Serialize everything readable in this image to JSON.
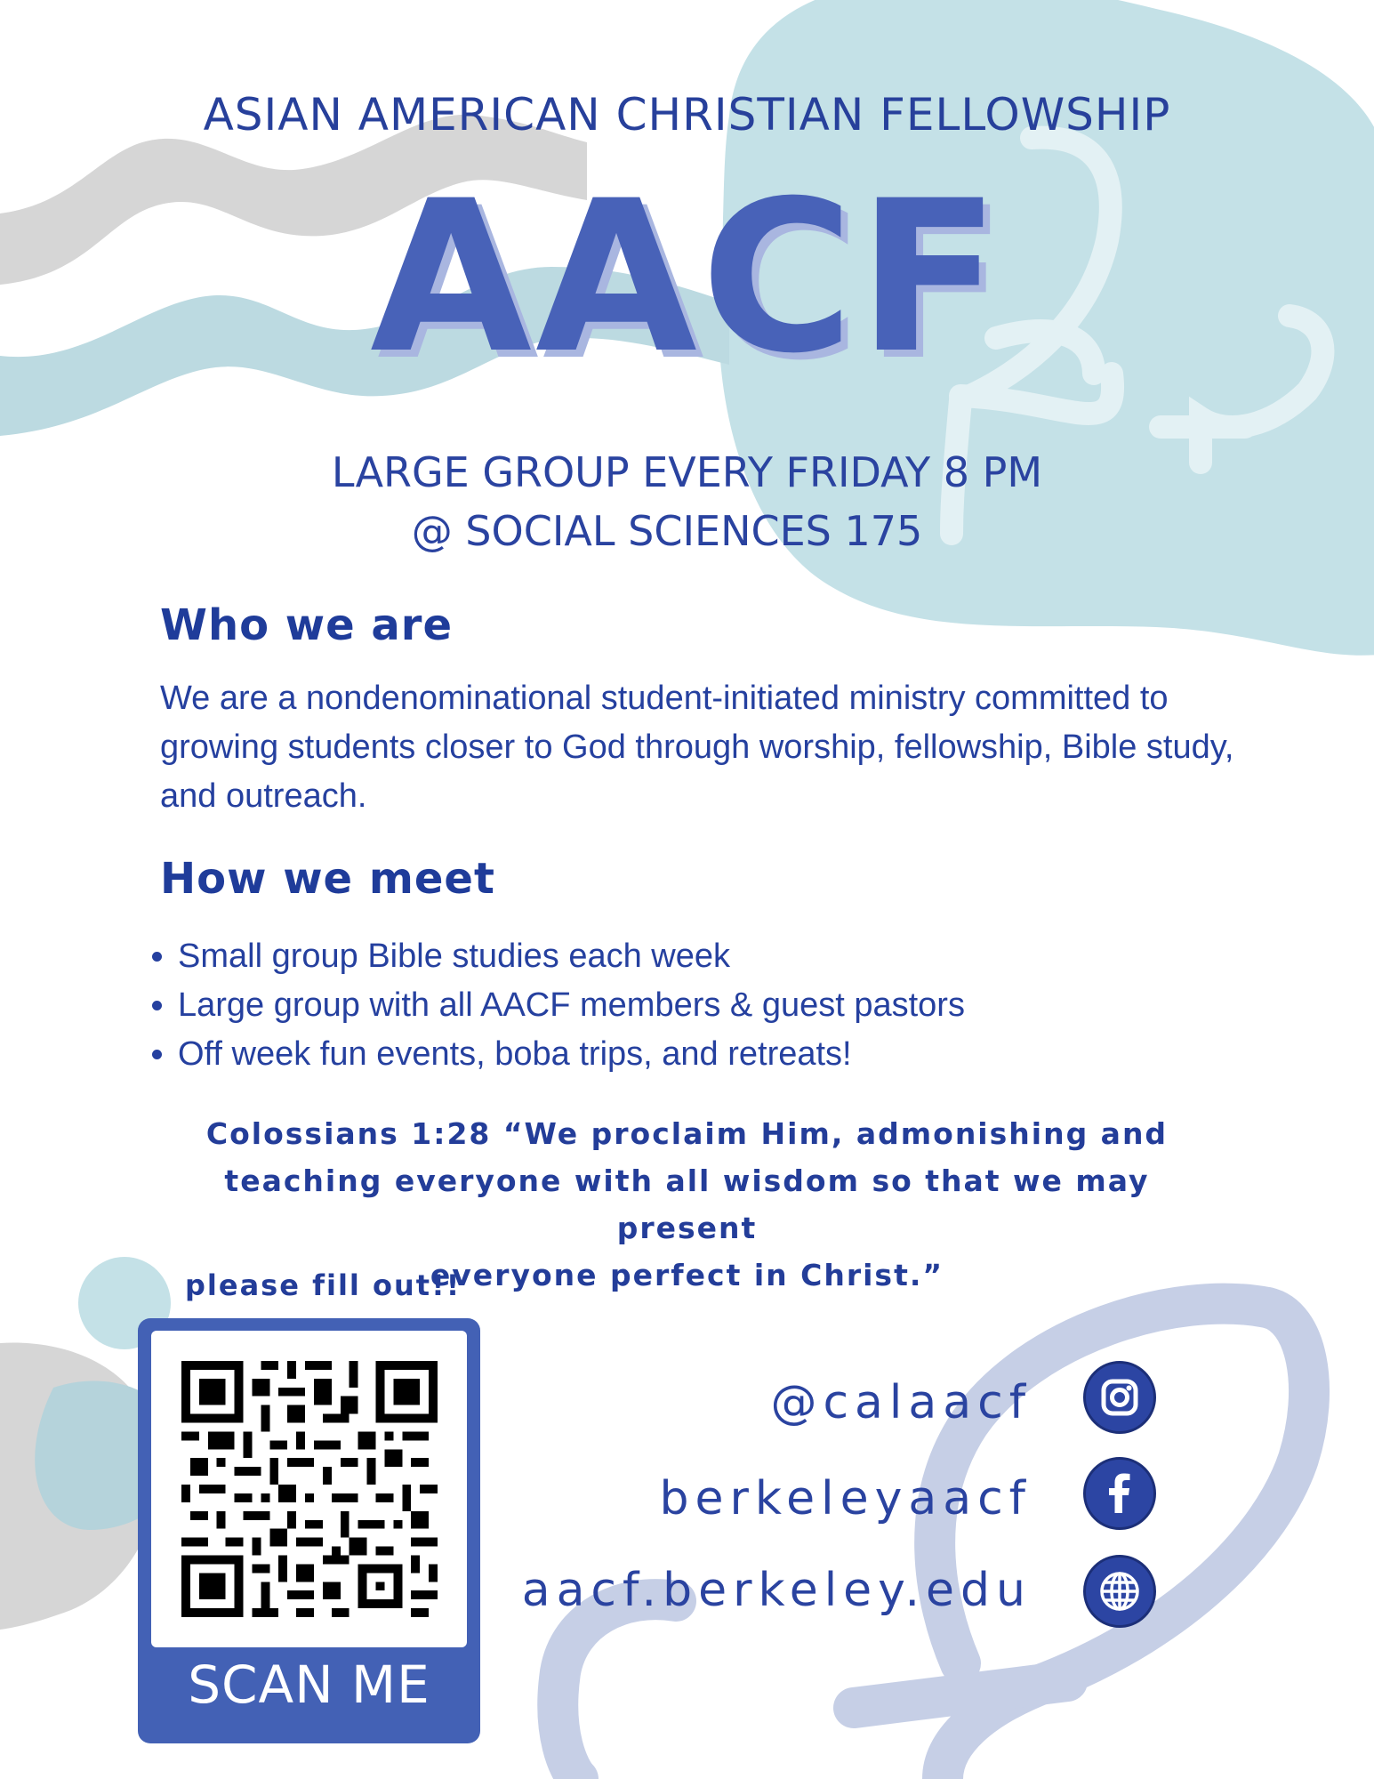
{
  "header": {
    "org_name": "ASIAN AMERICAN CHRISTIAN FELLOWSHIP",
    "acronym": "AACF",
    "meeting_line1": "LARGE GROUP EVERY FRIDAY 8 PM",
    "meeting_line2": "@ SOCIAL SCIENCES 175"
  },
  "who": {
    "heading": "Who we are",
    "body": "We are a nondenominational student-initiated ministry committed to growing students closer to God through worship, fellowship, Bible study, and outreach."
  },
  "how": {
    "heading": "How we meet",
    "items": [
      "Small group Bible studies each week",
      "Large group with all AACF members & guest pastors",
      "Off week fun events, boba trips, and retreats!"
    ]
  },
  "verse": {
    "line1": "Colossians 1:28 “We proclaim Him, admonishing and",
    "line2": "teaching everyone with all wisdom so that we may present",
    "line3": "everyone perfect in Christ.”"
  },
  "qr": {
    "note": "please fill out!!",
    "label": "SCAN ME"
  },
  "socials": [
    {
      "handle": "@calaacf",
      "icon": "instagram-icon"
    },
    {
      "handle": "berkeleyaacf",
      "icon": "facebook-icon"
    },
    {
      "handle": "aacf.berkeley.edu",
      "icon": "globe-icon"
    }
  ],
  "colors": {
    "primary_blue": "#1f3c9a",
    "accent_blue": "#4862b8",
    "light_teal": "#c4e1e7",
    "lavender": "#c6cfe6",
    "gray": "#d6d6d6"
  }
}
